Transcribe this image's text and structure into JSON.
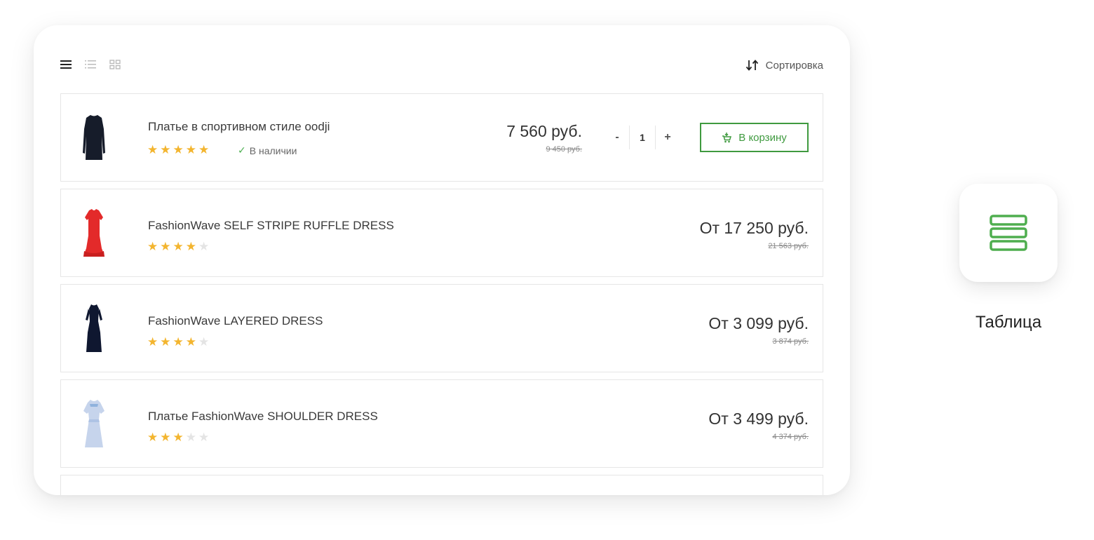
{
  "toolbar": {
    "view_icons": [
      "list-view-icon",
      "compact-list-view-icon",
      "grid-view-icon"
    ],
    "sort_label": "Сортировка"
  },
  "products": [
    {
      "title": "Платье в спортивном стиле oodji",
      "rating": 5,
      "stock": "В наличии",
      "price": "7 560 руб.",
      "old_price": "9 450 руб.",
      "quantity": "1",
      "qty_minus": "-",
      "qty_plus": "+",
      "cart_label": "В корзину"
    },
    {
      "title": "FashionWave SELF STRIPE RUFFLE DRESS",
      "rating": 4,
      "price": "От 17 250 руб.",
      "old_price": "21 563 руб."
    },
    {
      "title": "FashionWave LAYERED DRESS",
      "rating": 4,
      "price": "От 3 099 руб.",
      "old_price": "3 874 руб."
    },
    {
      "title": "Платье FashionWave SHOULDER DRESS",
      "rating": 3,
      "price": "От 3 499 руб.",
      "old_price": "4 374 руб."
    }
  ],
  "side_view": {
    "icon": "table-view-icon",
    "label": "Таблица"
  },
  "colors": {
    "accent_green": "#3f9a3f",
    "icon_green": "#4fae4f",
    "star": "#f3b52f",
    "star_empty": "#e4e4e4"
  }
}
